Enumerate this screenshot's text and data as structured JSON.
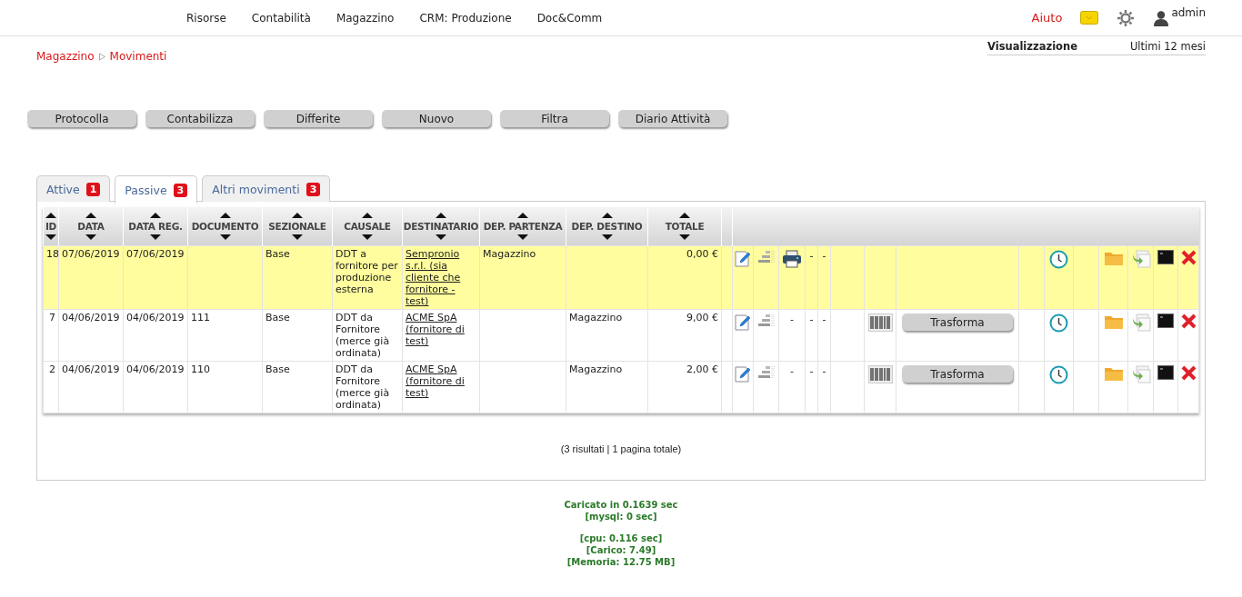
{
  "nav": {
    "menu": [
      "Risorse",
      "Contabilità",
      "Magazzino",
      "CRM: Produzione",
      "Doc&Comm"
    ],
    "help": "Aiuto",
    "user": "admin"
  },
  "breadcrumb": [
    "Magazzino",
    "Movimenti"
  ],
  "view_filter": {
    "label": "Visualizzazione",
    "value": "Ultimi 12 mesi"
  },
  "buttons": [
    "Protocolla",
    "Contabilizza",
    "Differite",
    "Nuovo",
    "Filtra",
    "Diario Attività"
  ],
  "tabs": [
    {
      "label": "Attive",
      "count": "1",
      "selected": false
    },
    {
      "label": "Passive",
      "count": "3",
      "selected": true
    },
    {
      "label": "Altri movimenti",
      "count": "3",
      "selected": false
    }
  ],
  "table": {
    "columns": [
      "ID",
      "DATA",
      "DATA REG.",
      "DOCUMENTO",
      "SEZIONALE",
      "CAUSALE",
      "DESTINATARIO",
      "DEP. PARTENZA",
      "DEP. DESTINO",
      "TOTALE"
    ],
    "rows": [
      {
        "selected": true,
        "id": "18",
        "date": "07/06/2019",
        "reg_date": "07/06/2019",
        "document": "",
        "sectional": "Base",
        "reason": "DDT a fornitore per produzione esterna",
        "recipient": "Sempronio s.r.l. (sia cliente che fornitore - test)",
        "dep_from": "Magazzino",
        "dep_to": "",
        "total": "0,00 €",
        "marks": [
          {
            "kind": "printer"
          },
          {
            "kind": "dash",
            "text": "-"
          },
          {
            "kind": "dash",
            "text": "-"
          }
        ],
        "barcode": false
      },
      {
        "selected": false,
        "id": "7",
        "date": "04/06/2019",
        "reg_date": "04/06/2019",
        "document": "111",
        "sectional": "Base",
        "reason": "DDT da Fornitore (merce già ordinata)",
        "recipient": "ACME SpA (fornitore di test)",
        "dep_from": "",
        "dep_to": "Magazzino",
        "total": "9,00 €",
        "marks": [
          {
            "kind": "dash",
            "text": "-"
          },
          {
            "kind": "dash",
            "text": "-"
          },
          {
            "kind": "dash",
            "text": "-"
          }
        ],
        "barcode": true,
        "action": "Trasforma"
      },
      {
        "selected": false,
        "id": "2",
        "date": "04/06/2019",
        "reg_date": "04/06/2019",
        "document": "110",
        "sectional": "Base",
        "reason": "DDT da Fornitore (merce già ordinata)",
        "recipient": "ACME SpA (fornitore di test)",
        "dep_from": "",
        "dep_to": "Magazzino",
        "total": "2,00 €",
        "marks": [
          {
            "kind": "dash",
            "text": "-"
          },
          {
            "kind": "dash",
            "text": "-"
          },
          {
            "kind": "dash",
            "text": "-"
          }
        ],
        "barcode": true,
        "action": "Trasforma"
      }
    ]
  },
  "pagination": "(3 risultati | 1 pagina totale)",
  "stats": [
    [
      "Caricato in 0.1639 sec",
      "[mysql: 0 sec]"
    ],
    [
      "[cpu: 0.116 sec]",
      "[Carico: 7.49]",
      "[Memoria: 12.75 MB]"
    ]
  ]
}
